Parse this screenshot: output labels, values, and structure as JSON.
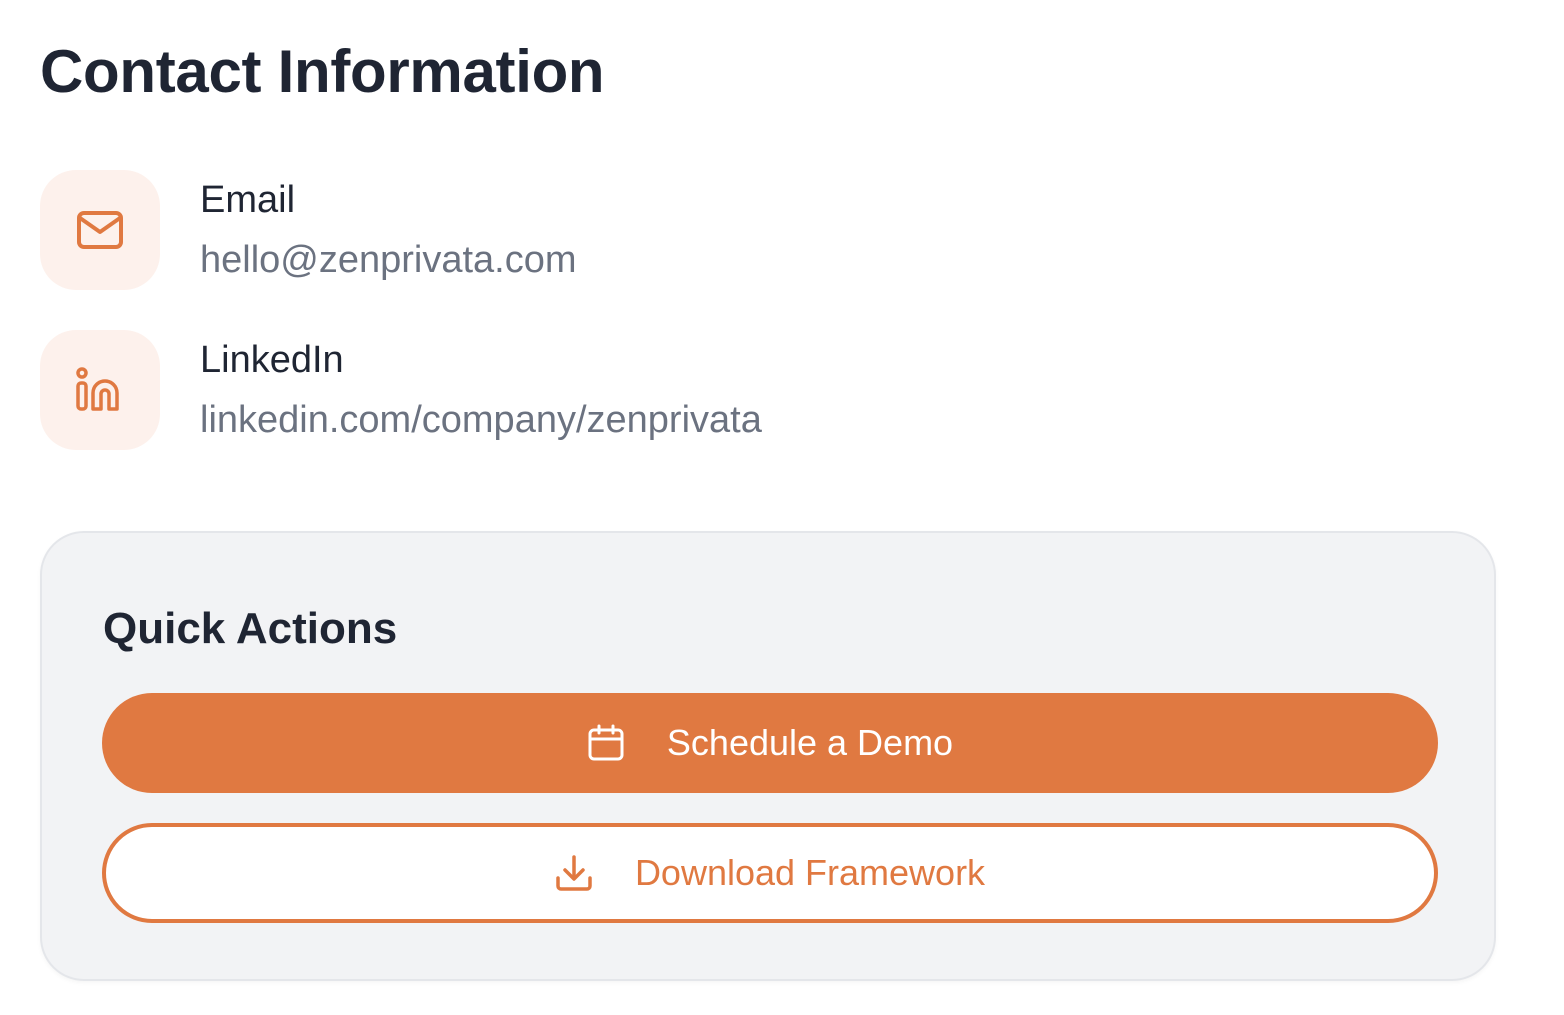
{
  "colors": {
    "accent": "#e07941",
    "icon_tile_bg": "#fdf1ec",
    "heading": "#1f2533",
    "muted_text": "#6b7280",
    "card_bg": "#f2f3f5"
  },
  "contact": {
    "title": "Contact Information",
    "items": [
      {
        "icon": "mail-icon",
        "label": "Email",
        "value": "hello@zenprivata.com"
      },
      {
        "icon": "linkedin-icon",
        "label": "LinkedIn",
        "value": "linkedin.com/company/zenprivata"
      }
    ]
  },
  "quick_actions": {
    "title": "Quick Actions",
    "schedule": {
      "icon": "calendar-icon",
      "label": "Schedule a Demo"
    },
    "download": {
      "icon": "download-icon",
      "label": "Download Framework"
    }
  }
}
